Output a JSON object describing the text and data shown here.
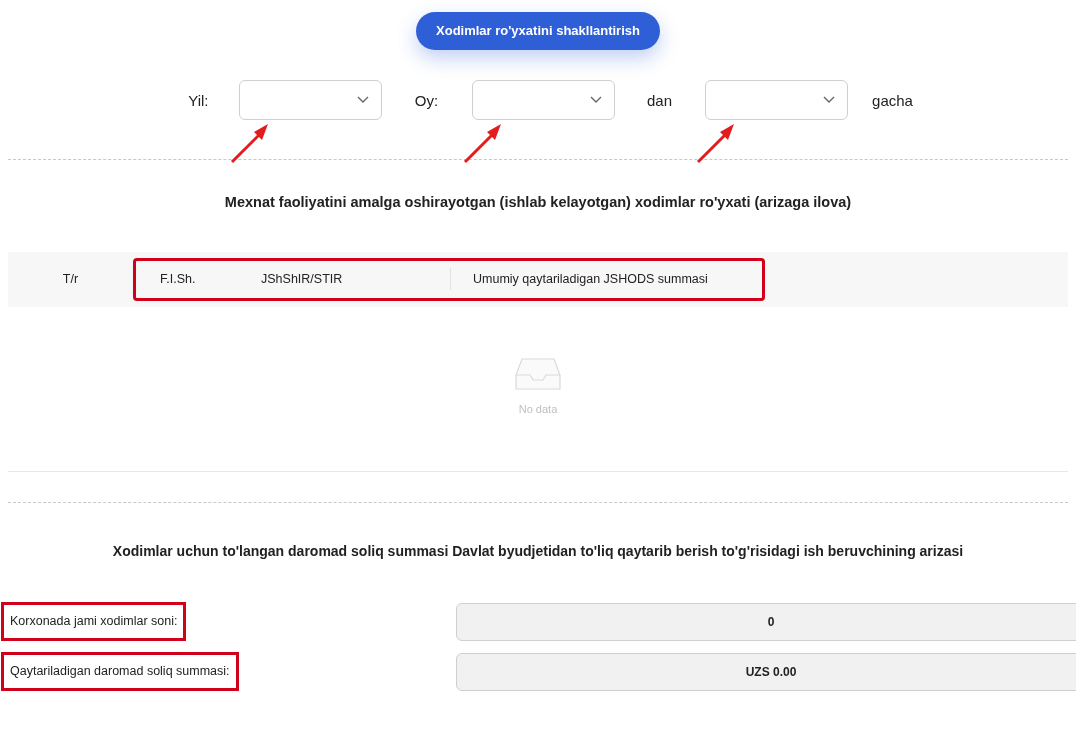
{
  "generate_button": "Xodimlar ro'yxatini shakllantirish",
  "filters": [
    {
      "label": "Yil:",
      "arrow": true
    },
    {
      "label": "Oy:",
      "arrow": true
    },
    {
      "label": "dan",
      "arrow": true
    }
  ],
  "filter_suffix": "gacha",
  "table": {
    "title": "Mexnat faoliyatini amalga oshirayotgan (ishlab kelayotgan) xodimlar ro'yxati (arizaga ilova)",
    "first_column": "T/r",
    "columns": [
      "F.I.Sh.",
      "JShShIR/STIR",
      "Umumiy qaytariladigan JSHODS summasi"
    ],
    "columns_highlighted": true,
    "empty_text": "No data"
  },
  "application": {
    "title": "Xodimlar uchun to'langan daromad soliq summasi Davlat byudjetidan to'liq qaytarib berish to'g'risidagi ish beruvchining arizasi",
    "fields": [
      {
        "label": "Korxonada jami xodimlar soni:",
        "value": "0",
        "highlighted": true
      },
      {
        "label": "Qaytariladigan daromad soliq summasi:",
        "value": "UZS 0.00",
        "highlighted": true
      }
    ]
  }
}
